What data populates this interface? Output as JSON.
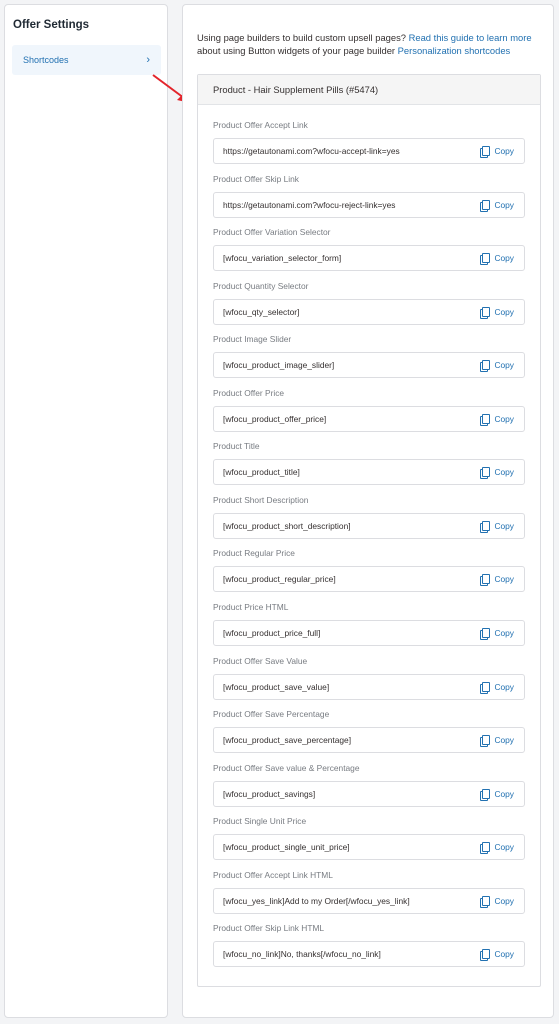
{
  "sidebar": {
    "title": "Offer Settings",
    "items": [
      {
        "label": "Shortcodes"
      }
    ]
  },
  "intro": {
    "text": "Using page builders to build custom upsell pages?",
    "guide_link": "Read this guide to learn more",
    "middle": "about using Button widgets of your page builder",
    "shortcodes_link": "Personalization shortcodes"
  },
  "product": {
    "title": "Product - Hair Supplement Pills (#5474)"
  },
  "copy_label": "Copy",
  "fields": [
    {
      "label": "Product Offer Accept Link",
      "value": "https://getautonami.com?wfocu-accept-link=yes"
    },
    {
      "label": "Product Offer Skip Link",
      "value": "https://getautonami.com?wfocu-reject-link=yes"
    },
    {
      "label": "Product Offer Variation Selector",
      "value": "[wfocu_variation_selector_form]"
    },
    {
      "label": "Product Quantity Selector",
      "value": "[wfocu_qty_selector]"
    },
    {
      "label": "Product Image Slider",
      "value": "[wfocu_product_image_slider]"
    },
    {
      "label": "Product Offer Price",
      "value": "[wfocu_product_offer_price]"
    },
    {
      "label": "Product Title",
      "value": "[wfocu_product_title]"
    },
    {
      "label": "Product Short Description",
      "value": "[wfocu_product_short_description]"
    },
    {
      "label": "Product Regular Price",
      "value": "[wfocu_product_regular_price]"
    },
    {
      "label": "Product Price HTML",
      "value": "[wfocu_product_price_full]"
    },
    {
      "label": "Product Offer Save Value",
      "value": "[wfocu_product_save_value]"
    },
    {
      "label": "Product Offer Save Percentage",
      "value": "[wfocu_product_save_percentage]"
    },
    {
      "label": "Product Offer Save value & Percentage",
      "value": "[wfocu_product_savings]"
    },
    {
      "label": "Product Single Unit Price",
      "value": "[wfocu_product_single_unit_price]"
    },
    {
      "label": "Product Offer Accept Link HTML",
      "value": "[wfocu_yes_link]Add to my Order[/wfocu_yes_link]"
    },
    {
      "label": "Product Offer Skip Link HTML",
      "value": "[wfocu_no_link]No, thanks[/wfocu_no_link]"
    }
  ],
  "colors": {
    "accent": "#2271b1",
    "arrow": "#e3242b"
  },
  "icons": {
    "chevron": "chevron-right-icon",
    "copy": "copy-icon",
    "arrow": "red-arrow-icon"
  }
}
